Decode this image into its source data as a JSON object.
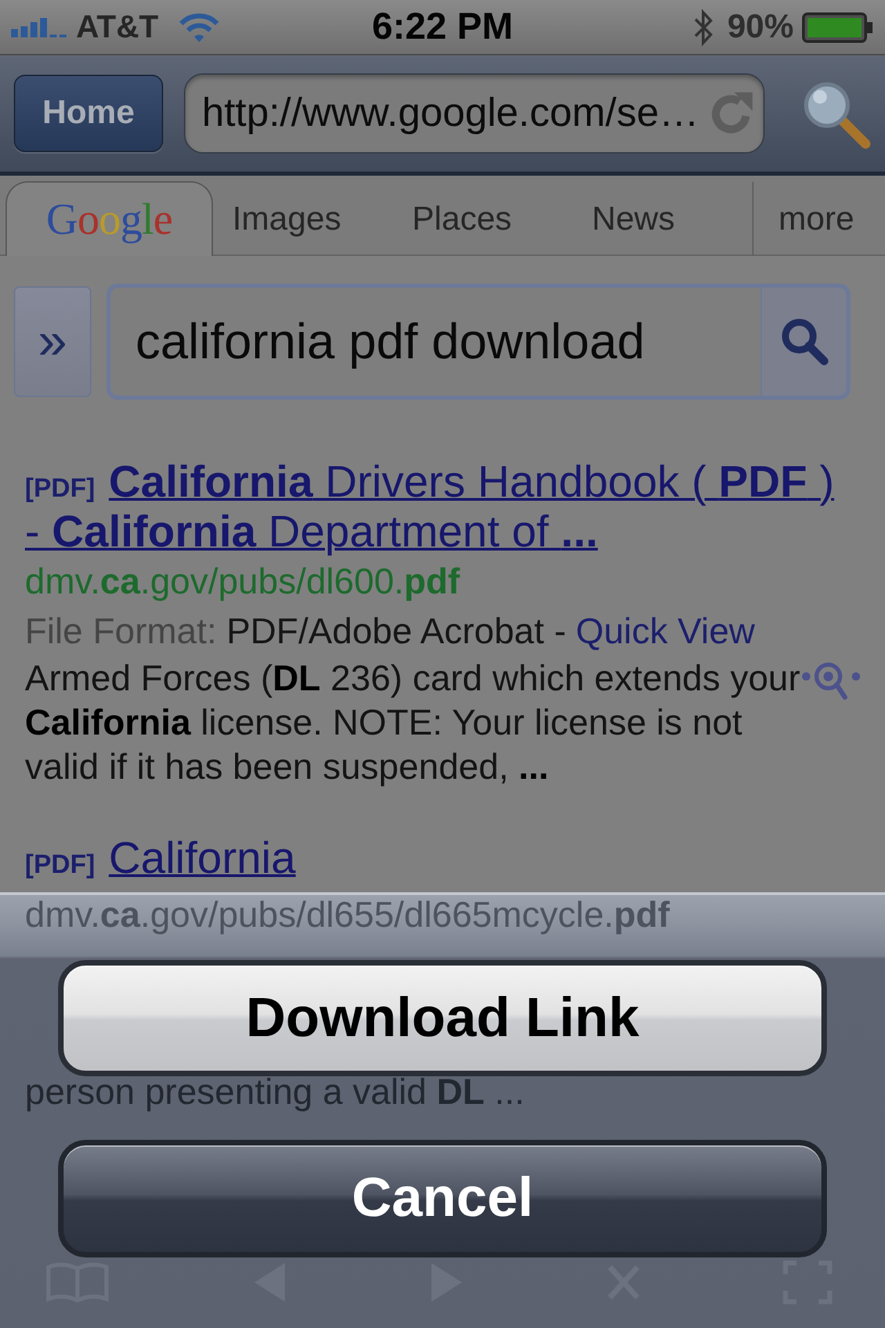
{
  "status_bar": {
    "carrier": "AT&T",
    "time": "6:22 PM",
    "battery": "90%"
  },
  "nav_bar": {
    "home_button": "Home",
    "url": "http://www.google.com/se…"
  },
  "tabs": [
    {
      "label": "Google",
      "kind": "logo",
      "selected": true
    },
    {
      "label": "Images",
      "kind": "text",
      "selected": false
    },
    {
      "label": "Places",
      "kind": "text",
      "selected": false
    },
    {
      "label": "News",
      "kind": "text",
      "selected": false
    },
    {
      "label": "more",
      "kind": "text",
      "selected": false
    }
  ],
  "search": {
    "expand_button": "»",
    "value": "california pdf download"
  },
  "results": [
    {
      "tag": "[PDF]",
      "title": "**California** Drivers Handbook ( **PDF** ) - **California** Department of **...**",
      "url": "dmv.**ca**.gov/pubs/dl600.**pdf**",
      "file_format": {
        "label": "File Format:",
        "value": "PDF/Adobe Acrobat -",
        "link": "Quick View"
      },
      "snippet": "Armed Forces (**DL** 236) card which extends your **California** license. NOTE: Your license is not valid if it has been suspended, **...**"
    },
    {
      "tag": "[PDF]",
      "title": "California"
    }
  ],
  "action_sheet": {
    "items": [
      {
        "kind": "faded_url",
        "text": "dmv.**ca**.gov/pubs/dl655/dl665mcycle.**pdf**"
      },
      {
        "kind": "button",
        "label": "Download Link"
      },
      {
        "kind": "faded_text",
        "text": "person presenting a valid **DL** ..."
      },
      {
        "kind": "cancel_button",
        "label": "Cancel"
      }
    ]
  }
}
